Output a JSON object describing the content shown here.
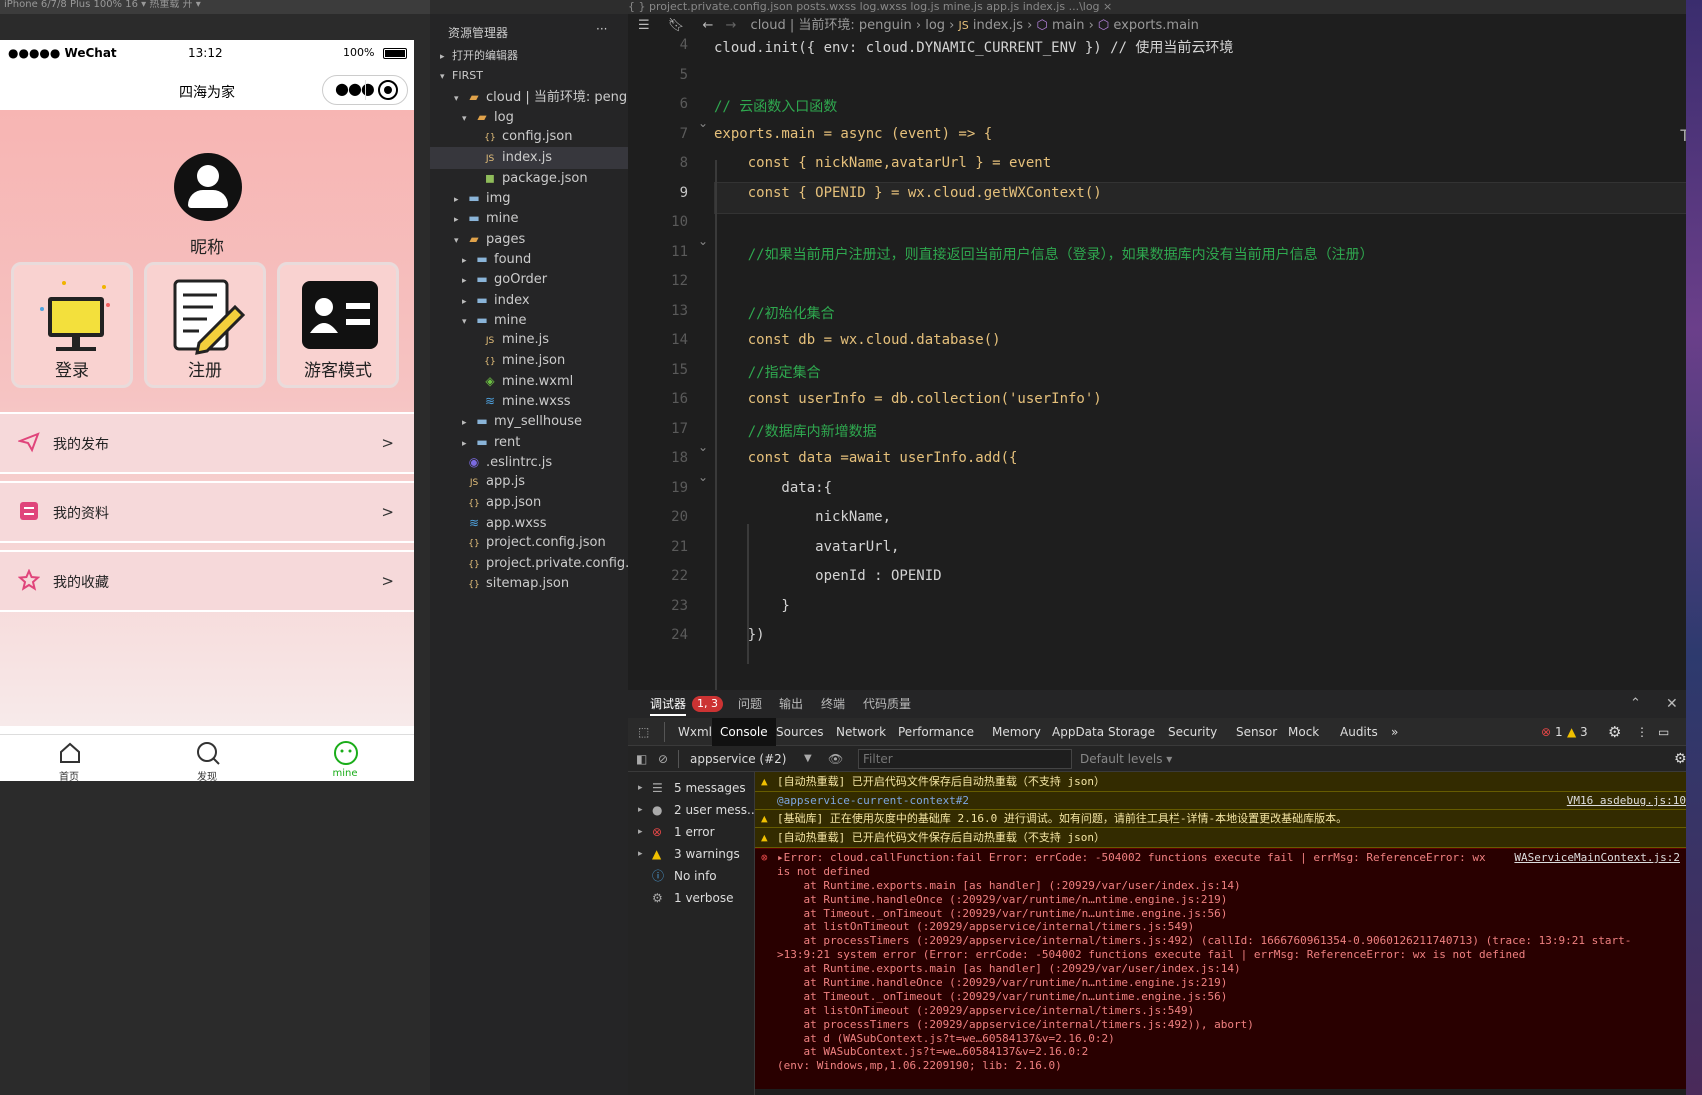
{
  "sim": {
    "top_text": "iPhone 6/7/8 Plus 100% 16 ▾   热重载 开 ▾",
    "status": {
      "carrier": "●●●●● WeChat",
      "time": "13:12",
      "battery": "100%"
    },
    "nav_title": "四海为家",
    "nickname": "昵称",
    "cards": [
      {
        "label": "登录"
      },
      {
        "label": "注册"
      },
      {
        "label": "游客模式"
      }
    ],
    "rows": [
      {
        "label": "我的发布",
        "arrow": ">"
      },
      {
        "label": "我的资料",
        "arrow": ">"
      },
      {
        "label": "我的收藏",
        "arrow": ">"
      }
    ],
    "tabbar": [
      {
        "label": "首页"
      },
      {
        "label": "发现"
      },
      {
        "label": "mine"
      }
    ],
    "accent": "#1aad19"
  },
  "explorer": {
    "title": "资源管理器",
    "more": "···",
    "items": [
      {
        "label": "打开的编辑器",
        "depth": 0,
        "twisty": "▸",
        "icon": ""
      },
      {
        "label": "FIRST",
        "depth": 0,
        "twisty": "▾",
        "icon": ""
      },
      {
        "label": "cloud | 当前环境: peng...",
        "depth": 1,
        "twisty": "▾",
        "icon": "folder-open"
      },
      {
        "label": "log",
        "depth": 2,
        "twisty": "▾",
        "icon": "folder-open"
      },
      {
        "label": "config.json",
        "depth": 3,
        "twisty": "",
        "icon": "json"
      },
      {
        "label": "index.js",
        "depth": 3,
        "twisty": "",
        "icon": "js"
      },
      {
        "label": "package.json",
        "depth": 3,
        "twisty": "",
        "icon": "npm"
      },
      {
        "label": "img",
        "depth": 1,
        "twisty": "▸",
        "icon": "folder"
      },
      {
        "label": "mine",
        "depth": 1,
        "twisty": "▸",
        "icon": "folder"
      },
      {
        "label": "pages",
        "depth": 1,
        "twisty": "▾",
        "icon": "folder-open"
      },
      {
        "label": "found",
        "depth": 2,
        "twisty": "▸",
        "icon": "folder"
      },
      {
        "label": "goOrder",
        "depth": 2,
        "twisty": "▸",
        "icon": "folder"
      },
      {
        "label": "index",
        "depth": 2,
        "twisty": "▸",
        "icon": "folder"
      },
      {
        "label": "mine",
        "depth": 2,
        "twisty": "▾",
        "icon": "folder"
      },
      {
        "label": "mine.js",
        "depth": 3,
        "twisty": "",
        "icon": "js"
      },
      {
        "label": "mine.json",
        "depth": 3,
        "twisty": "",
        "icon": "json"
      },
      {
        "label": "mine.wxml",
        "depth": 3,
        "twisty": "",
        "icon": "wxml"
      },
      {
        "label": "mine.wxss",
        "depth": 3,
        "twisty": "",
        "icon": "wxss"
      },
      {
        "label": "my_sellhouse",
        "depth": 2,
        "twisty": "▸",
        "icon": "folder"
      },
      {
        "label": "rent",
        "depth": 2,
        "twisty": "▸",
        "icon": "folder"
      },
      {
        "label": ".eslintrc.js",
        "depth": 1,
        "twisty": "",
        "icon": "eslint"
      },
      {
        "label": "app.js",
        "depth": 1,
        "twisty": "",
        "icon": "js"
      },
      {
        "label": "app.json",
        "depth": 1,
        "twisty": "",
        "icon": "json"
      },
      {
        "label": "app.wxss",
        "depth": 1,
        "twisty": "",
        "icon": "wxss"
      },
      {
        "label": "project.config.json",
        "depth": 1,
        "twisty": "",
        "icon": "json"
      },
      {
        "label": "project.private.config.js...",
        "depth": 1,
        "twisty": "",
        "icon": "json"
      },
      {
        "label": "sitemap.json",
        "depth": 1,
        "twisty": "",
        "icon": "json"
      }
    ]
  },
  "editor": {
    "tabs": "{ } project.private.config.json     posts.wxss     log.wxss     log.js     mine.js     app.js     index.js ...\\log  ×",
    "crumbs": [
      "cloud | 当前环境: penguin",
      "log",
      "index.js",
      "main",
      "exports.main"
    ],
    "lines": [
      {
        "n": "4",
        "t": "cloud.init({ env: cloud.DYNAMIC_CURRENT_ENV }) // 使用当前云环境"
      },
      {
        "n": "5",
        "t": ""
      },
      {
        "n": "6",
        "t": "// 云函数入口函数"
      },
      {
        "n": "7",
        "t": "exports.main = async (event) => {"
      },
      {
        "n": "8",
        "t": "    const { nickName,avatarUrl } = event"
      },
      {
        "n": "9",
        "t": "    const { OPENID } = wx.cloud.getWXContext()"
      },
      {
        "n": "10",
        "t": ""
      },
      {
        "n": "11",
        "t": "    //如果当前用户注册过，则直接返回当前用户信息（登录），如果数据库内没有当前用户信息（注册）"
      },
      {
        "n": "12",
        "t": ""
      },
      {
        "n": "13",
        "t": "    //初始化集合"
      },
      {
        "n": "14",
        "t": "    const db = wx.cloud.database()"
      },
      {
        "n": "15",
        "t": "    //指定集合"
      },
      {
        "n": "16",
        "t": "    const userInfo = db.collection('userInfo')"
      },
      {
        "n": "17",
        "t": "    //数据库内新增数据"
      },
      {
        "n": "18",
        "t": "    const data =await userInfo.add({"
      },
      {
        "n": "19",
        "t": "        data:{"
      },
      {
        "n": "20",
        "t": "            nickName,"
      },
      {
        "n": "21",
        "t": "            avatarUrl,"
      },
      {
        "n": "22",
        "t": "            openId : OPENID"
      },
      {
        "n": "23",
        "t": "        }"
      },
      {
        "n": "24",
        "t": "    })"
      }
    ]
  },
  "panel": {
    "tabs": [
      "调试器",
      "问题",
      "输出",
      "终端",
      "代码质量"
    ],
    "badge": "1, 3",
    "devtools_tabs": [
      "Wxml",
      "Console",
      "Sources",
      "Network",
      "Performance",
      "Memory",
      "AppData",
      "Storage",
      "Security",
      "Sensor",
      "Mock",
      "Audits",
      "»"
    ],
    "error_count": "1",
    "warn_count": "3",
    "context": "appservice (#2)",
    "filter_placeholder": "Filter",
    "levels": "Default levels ▾",
    "sidebar": [
      {
        "label": "5 messages",
        "icon": "list-icon"
      },
      {
        "label": "2 user mess...",
        "icon": "user-icon"
      },
      {
        "label": "1 error",
        "icon": "error-icon"
      },
      {
        "label": "3 warnings",
        "icon": "warning-icon"
      },
      {
        "label": "No info",
        "icon": "info-icon"
      },
      {
        "label": "1 verbose",
        "icon": "gear-icon"
      }
    ],
    "log": {
      "warn1": "[自动热重载] 已开启代码文件保存后自动热重载（不支持 json）",
      "ctx": "@appservice-current-context#2",
      "ctx_src": "VM16 asdebug.js:10",
      "warn2": "[基础库] 正在使用灰度中的基础库 2.16.0 进行调试。如有问题，请前往工具栏-详情-本地设置更改基础库版本。",
      "warn3": "[自动热重载] 已开启代码文件保存后自动热重载（不支持 json）",
      "err_src": "WAServiceMainContext.js:2",
      "err_lines": [
        "▸Error: cloud.callFunction:fail Error: errCode: -504002 functions execute fail | errMsg: ReferenceError: wx",
        "is not defined",
        "    at Runtime.exports.main [as handler] (:20929/var/user/index.js:14)",
        "    at Runtime.handleOnce (:20929/var/runtime/n…ntime.engine.js:219)",
        "    at Timeout._onTimeout (:20929/var/runtime/n…untime.engine.js:56)",
        "    at listOnTimeout (:20929/appservice/internal/timers.js:549)",
        "    at processTimers (:20929/appservice/internal/timers.js:492) (callId: 1666760961354-0.9060126211740713) (trace: 13:9:21 start-",
        ">13:9:21 system error (Error: errCode: -504002 functions execute fail | errMsg: ReferenceError: wx is not defined",
        "    at Runtime.exports.main [as handler] (:20929/var/user/index.js:14)",
        "    at Runtime.handleOnce (:20929/var/runtime/n…ntime.engine.js:219)",
        "    at Timeout._onTimeout (:20929/var/runtime/n…untime.engine.js:56)",
        "    at listOnTimeout (:20929/appservice/internal/timers.js:549)",
        "    at processTimers (:20929/appservice/internal/timers.js:492)), abort)",
        "    at d (WASubContext.js?t=we…6058413​7&v=2.16.0:2)",
        "    at WASubContext.js?t=we…6058413​7&v=2.16.0:2",
        "(env: Windows,mp,1.06.2209190; lib: 2.16.0)"
      ]
    }
  }
}
